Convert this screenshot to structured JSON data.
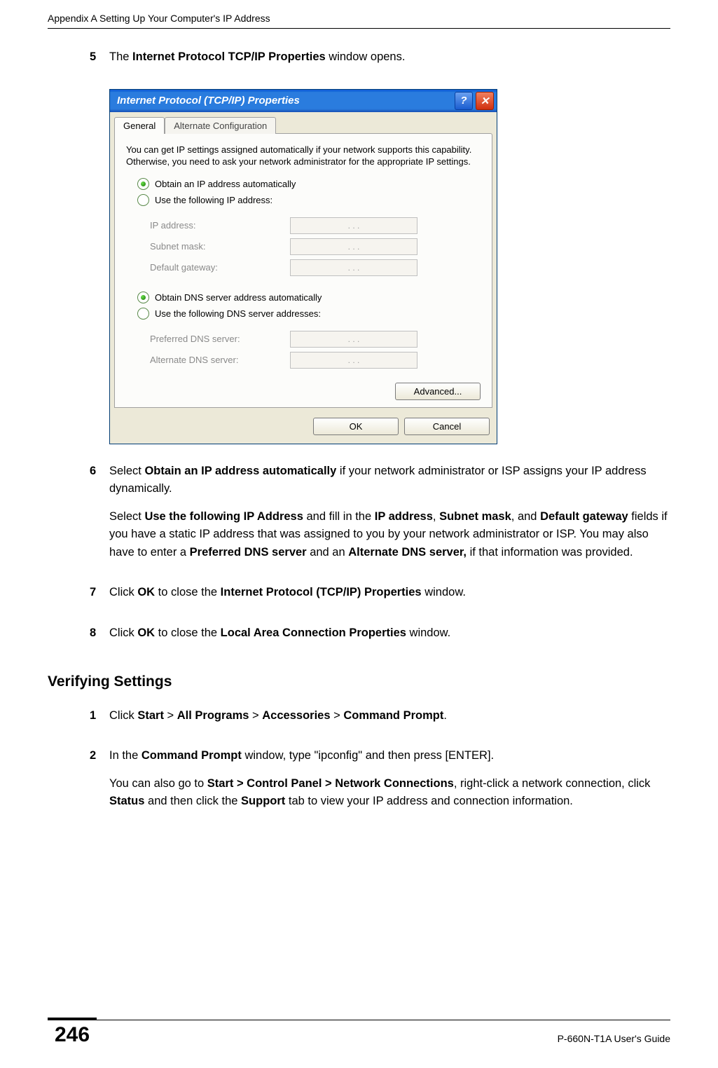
{
  "header": {
    "running": "Appendix A Setting Up Your Computer's IP Address"
  },
  "steps": {
    "s5_num": "5",
    "s5_a": "The ",
    "s5_b": "Internet Protocol TCP/IP Properties",
    "s5_c": " window opens.",
    "s6_num": "6",
    "s6_p1_a": "Select ",
    "s6_p1_b": "Obtain an IP address automatically",
    "s6_p1_c": " if your network administrator or ISP assigns your IP address dynamically.",
    "s6_p2_a": "Select ",
    "s6_p2_b": "Use the following IP Address",
    "s6_p2_c": " and fill in the ",
    "s6_p2_d": "IP address",
    "s6_p2_e": ", ",
    "s6_p2_f": "Subnet mask",
    "s6_p2_g": ", and ",
    "s6_p2_h": "Default gateway",
    "s6_p2_i": " fields if you have a static IP address that was assigned to you by your network administrator or ISP. You may also have to enter a ",
    "s6_p2_j": "Preferred DNS server",
    "s6_p2_k": " and an ",
    "s6_p2_l": "Alternate DNS server,",
    "s6_p2_m": " if that information was provided.",
    "s7_num": "7",
    "s7_a": "Click ",
    "s7_b": "OK",
    "s7_c": " to close the ",
    "s7_d": "Internet Protocol (TCP/IP) Properties",
    "s7_e": " window.",
    "s8_num": "8",
    "s8_a": "Click ",
    "s8_b": "OK",
    "s8_c": " to close the ",
    "s8_d": "Local Area Connection Properties",
    "s8_e": " window."
  },
  "subheading": "Verifying Settings",
  "verify": {
    "v1_num": "1",
    "v1_a": "Click ",
    "v1_b": "Start",
    "v1_c": " > ",
    "v1_d": "All Programs",
    "v1_e": " > ",
    "v1_f": "Accessories",
    "v1_g": " > ",
    "v1_h": "Command Prompt",
    "v1_i": ".",
    "v2_num": "2",
    "v2_p1_a": "In the ",
    "v2_p1_b": "Command Prompt",
    "v2_p1_c": " window, type \"ipconfig\" and then press [ENTER].",
    "v2_p2_a": "You can also go to ",
    "v2_p2_b": "Start > Control Panel > Network Connections",
    "v2_p2_c": ", right-click a network connection, click ",
    "v2_p2_d": "Status",
    "v2_p2_e": " and then click the ",
    "v2_p2_f": "Support",
    "v2_p2_g": " tab to view your IP address and connection information."
  },
  "dialog": {
    "title": "Internet Protocol (TCP/IP) Properties",
    "help_glyph": "?",
    "close_glyph": "✕",
    "tab_general": "General",
    "tab_alt": "Alternate Configuration",
    "desc": "You can get IP settings assigned automatically if your network supports this capability. Otherwise, you need to ask your network administrator for the appropriate IP settings.",
    "radio_obtain_ip": "Obtain an IP address automatically",
    "radio_use_ip": "Use the following IP address:",
    "lbl_ip": "IP address:",
    "lbl_subnet": "Subnet mask:",
    "lbl_gateway": "Default gateway:",
    "radio_obtain_dns": "Obtain DNS server address automatically",
    "radio_use_dns": "Use the following DNS server addresses:",
    "lbl_pref_dns": "Preferred DNS server:",
    "lbl_alt_dns": "Alternate DNS server:",
    "dots": ".     .     .",
    "btn_advanced": "Advanced...",
    "btn_ok": "OK",
    "btn_cancel": "Cancel"
  },
  "footer": {
    "page": "246",
    "guide": "P-660N-T1A User's Guide"
  }
}
